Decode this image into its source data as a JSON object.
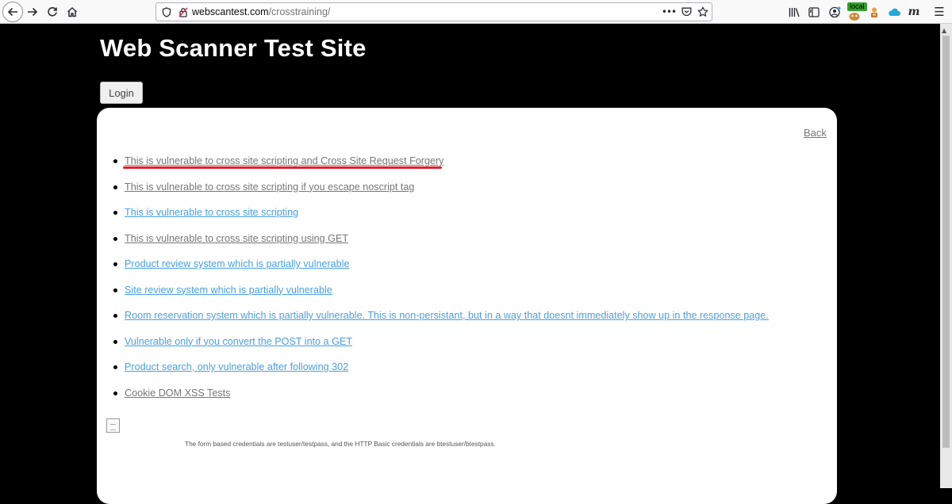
{
  "browser": {
    "url_host": "webscantest.com",
    "url_path": "/crosstraining/",
    "badge": "local",
    "menu_glyph": "☰",
    "icons": [
      "back-icon",
      "forward-icon",
      "reload-icon",
      "home-icon",
      "shield-icon",
      "insecure-lock-icon",
      "more-icon",
      "pocket-icon",
      "bookmark-star-icon",
      "library-icon",
      "sidebar-icon",
      "account-icon",
      "extension-icon",
      "extension2-icon",
      "cloud-icon",
      "m-icon",
      "menu-icon"
    ]
  },
  "page": {
    "title": "Web Scanner Test Site",
    "login_label": "Login",
    "back_label": "Back",
    "links": [
      {
        "text": "This is vulnerable to cross site scripting and Cross Site Request Forgery",
        "visited": true
      },
      {
        "text": "This is vulnerable to cross site scripting if you escape noscript tag",
        "visited": true
      },
      {
        "text": "This is vulnerable to cross site scripting",
        "visited": false
      },
      {
        "text": "This is vulnerable to cross site scripting using GET",
        "visited": true
      },
      {
        "text": "Product review system which is partially vulnerable",
        "visited": false
      },
      {
        "text": "Site review system which is partially vulnerable",
        "visited": false
      },
      {
        "text": "Room reservation system which is partially vulnerable. This is non-persistant, but in a way that doesnt immediately show up in the response page.",
        "visited": false
      },
      {
        "text": "Vulnerable only if you convert the POST into a GET",
        "visited": false
      },
      {
        "text": "Product search, only vulnerable after following 302",
        "visited": false
      },
      {
        "text": "Cookie DOM XSS Tests",
        "visited": true
      }
    ],
    "credentials_note": "The form based credentials are testuser/testpass, and the HTTP Basic credentials are btestuser/btestpass."
  },
  "colors": {
    "page_background": "#000000",
    "visited_link": "#777777",
    "link": "#4a9fe2",
    "annotation_underline": "#e01e2e"
  }
}
